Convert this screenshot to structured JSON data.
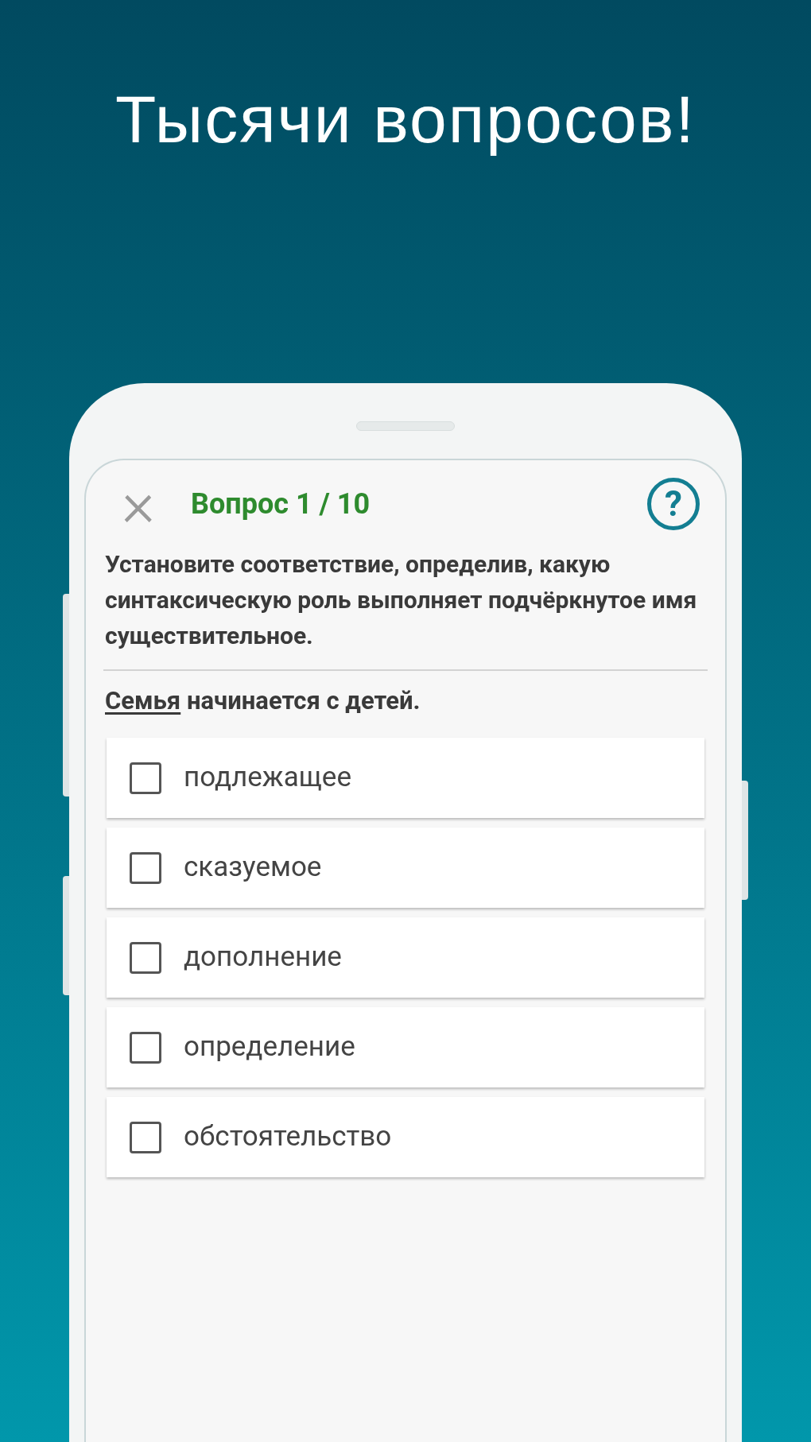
{
  "headline": "Тысячи вопросов!",
  "header": {
    "close": "×",
    "title": "Вопрос 1 / 10",
    "help": "?"
  },
  "question": "Установите соответствие, определив, какую синтаксическую роль выполняет подчёркнутое имя существительное.",
  "sentence": {
    "underlined": "Семья",
    "rest": "начинается с детей."
  },
  "options": [
    {
      "label": "подлежащее",
      "checked": false
    },
    {
      "label": "сказуемое",
      "checked": false
    },
    {
      "label": "дополнение",
      "checked": false
    },
    {
      "label": "определение",
      "checked": false
    },
    {
      "label": "обстоятельство",
      "checked": false
    }
  ]
}
